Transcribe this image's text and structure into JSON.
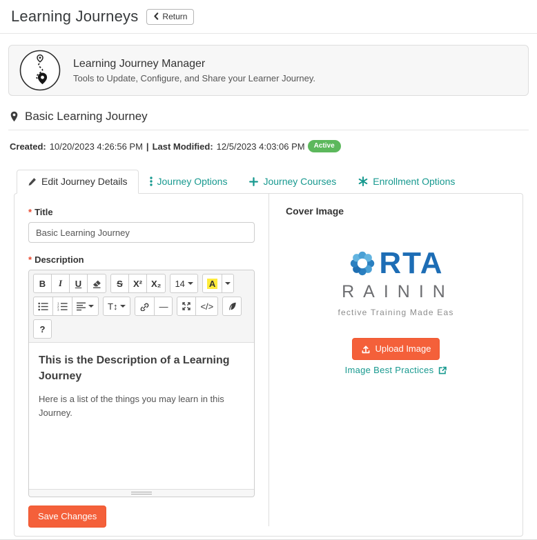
{
  "header": {
    "title": "Learning Journeys",
    "return_label": "Return"
  },
  "banner": {
    "title": "Learning Journey Manager",
    "subtitle": "Tools to Update, Configure, and Share your Learner Journey."
  },
  "journey": {
    "name": "Basic Learning Journey",
    "created_label": "Created:",
    "created_value": "10/20/2023 4:26:56 PM",
    "separator": "|",
    "modified_label": "Last Modified:",
    "modified_value": "12/5/2023 4:03:06 PM",
    "status_badge": "Active"
  },
  "tabs": [
    {
      "label": "Edit Journey Details",
      "icon": "pencil-icon",
      "active": true
    },
    {
      "label": "Journey Options",
      "icon": "vertical-dots-icon",
      "active": false
    },
    {
      "label": "Journey Courses",
      "icon": "plus-icon",
      "active": false
    },
    {
      "label": "Enrollment Options",
      "icon": "asterisk-icon",
      "active": false
    }
  ],
  "form": {
    "required_marker": "*",
    "title_label": "Title",
    "title_value": "Basic Learning Journey",
    "description_label": "Description"
  },
  "editor": {
    "toolbar": {
      "bold": "B",
      "italic": "I",
      "underline": "U",
      "strikethrough": "S",
      "superscript": "X²",
      "subscript": "X₂",
      "font_size": "14",
      "color": "A",
      "line_height": "T↕",
      "hr": "—",
      "codeview": "</>",
      "help": "?"
    },
    "toolbar_icons": [
      "eraser-icon",
      "unordered-list-icon",
      "ordered-list-icon",
      "align-icon",
      "caret-down-icon",
      "link-icon",
      "fullscreen-icon",
      "feather-icon"
    ],
    "content": {
      "heading": "This is the Description of a Learning Journey",
      "paragraph": "Here is a list of the things you may learn in this Journey."
    }
  },
  "cover": {
    "label": "Cover Image",
    "logo": {
      "word_top": "RTA",
      "word_bottom": "RAININ",
      "tagline": "fective Training Made Eas"
    },
    "upload_label": "Upload Image",
    "best_practices_label": "Image Best Practices"
  },
  "actions": {
    "save_label": "Save Changes"
  },
  "colors": {
    "accent_teal": "#17998f",
    "accent_orange": "#f4603a",
    "status_green": "#5cb85c",
    "required_red": "#e8492f",
    "logo_blue": "#1d6db5",
    "logo_gray": "#6d6e71"
  }
}
